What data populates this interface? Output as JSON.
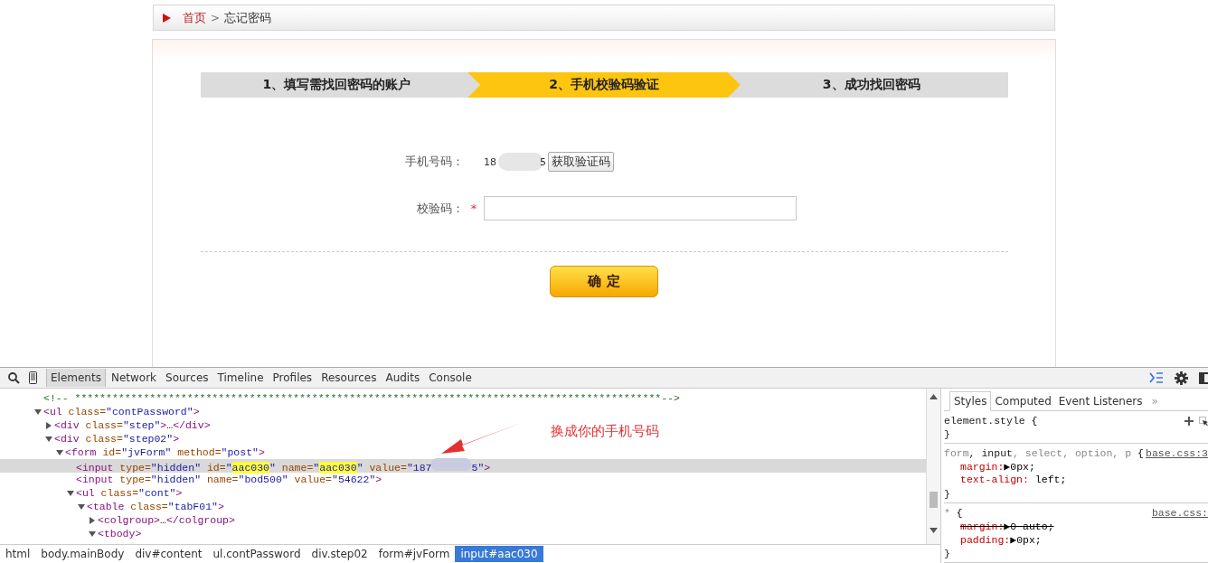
{
  "breadcrumb": {
    "home": "首页",
    "separator": ">",
    "current": "忘记密码"
  },
  "steps": [
    {
      "label": "1、填写需找回密码的账户",
      "selected": false
    },
    {
      "label": "2、手机校验码验证",
      "selected": true
    },
    {
      "label": "3、成功找回密码",
      "selected": false
    }
  ],
  "form": {
    "phone_label": "手机号码：",
    "phone_start": "18",
    "phone_end": "5",
    "send_code_button": "获取验证码",
    "code_label": "校验码：",
    "required_mark": "*",
    "submit_button": "确 定"
  },
  "devtools": {
    "tabs": [
      {
        "label": "Elements",
        "selected": true
      },
      {
        "label": "Network",
        "selected": false
      },
      {
        "label": "Sources",
        "selected": false
      },
      {
        "label": "Timeline",
        "selected": false
      },
      {
        "label": "Profiles",
        "selected": false
      },
      {
        "label": "Resources",
        "selected": false
      },
      {
        "label": "Audits",
        "selected": false
      },
      {
        "label": "Console",
        "selected": false
      }
    ],
    "tree": [
      {
        "parts": [
          {
            "kind": "comment",
            "t": "<!-- **********************************************************************************************-->"
          }
        ]
      },
      {
        "expanded": true,
        "parts": [
          {
            "kind": "tag",
            "t": "<ul"
          },
          {
            "kind": "attr",
            "t": " class="
          },
          {
            "kind": "value",
            "t": "\"contPassword\""
          },
          {
            "kind": "tag",
            "t": ">"
          }
        ],
        "children": [
          {
            "expanded": false,
            "parts": [
              {
                "kind": "tag",
                "t": "<div"
              },
              {
                "kind": "attr",
                "t": " class="
              },
              {
                "kind": "value",
                "t": "\"step\""
              },
              {
                "kind": "tag",
                "t": ">"
              },
              {
                "kind": "text",
                "t": "…"
              },
              {
                "kind": "tag",
                "t": "</div>"
              }
            ]
          },
          {
            "expanded": true,
            "parts": [
              {
                "kind": "tag",
                "t": "<div"
              },
              {
                "kind": "attr",
                "t": " class="
              },
              {
                "kind": "value",
                "t": "\"step02\""
              },
              {
                "kind": "tag",
                "t": ">"
              }
            ],
            "children": [
              {
                "expanded": true,
                "parts": [
                  {
                    "kind": "tag",
                    "t": "<form"
                  },
                  {
                    "kind": "attr",
                    "t": " id="
                  },
                  {
                    "kind": "value",
                    "t": "\"jvForm\""
                  },
                  {
                    "kind": "attr",
                    "t": " method="
                  },
                  {
                    "kind": "value",
                    "t": "\"post\""
                  },
                  {
                    "kind": "tag",
                    "t": ">"
                  }
                ],
                "children": [
                  {
                    "selected": true,
                    "parts": [
                      {
                        "kind": "tag",
                        "t": "<input"
                      },
                      {
                        "kind": "attr",
                        "t": " type="
                      },
                      {
                        "kind": "value",
                        "t": "\"hidden\""
                      },
                      {
                        "kind": "attr",
                        "t": " id="
                      },
                      {
                        "kind": "value",
                        "t": "\""
                      },
                      {
                        "kind": "mark",
                        "t": "aac030"
                      },
                      {
                        "kind": "value",
                        "t": "\""
                      },
                      {
                        "kind": "attr",
                        "t": " name="
                      },
                      {
                        "kind": "value",
                        "t": "\""
                      },
                      {
                        "kind": "mark",
                        "t": "aac030"
                      },
                      {
                        "kind": "value",
                        "t": "\""
                      },
                      {
                        "kind": "attr",
                        "t": " value="
                      },
                      {
                        "kind": "value",
                        "t": "\"187"
                      },
                      {
                        "kind": "blur"
                      },
                      {
                        "kind": "value",
                        "t": "5\""
                      },
                      {
                        "kind": "tag",
                        "t": ">"
                      }
                    ]
                  },
                  {
                    "selected": false,
                    "parts": [
                      {
                        "kind": "tag",
                        "t": "<input"
                      },
                      {
                        "kind": "attr",
                        "t": " type="
                      },
                      {
                        "kind": "value",
                        "t": "\"hidden\""
                      },
                      {
                        "kind": "attr",
                        "t": " name="
                      },
                      {
                        "kind": "value",
                        "t": "\"bod500\""
                      },
                      {
                        "kind": "attr",
                        "t": " value="
                      },
                      {
                        "kind": "value",
                        "t": "\"54622\""
                      },
                      {
                        "kind": "tag",
                        "t": ">"
                      }
                    ]
                  },
                  {
                    "expanded": true,
                    "parts": [
                      {
                        "kind": "tag",
                        "t": "<ul"
                      },
                      {
                        "kind": "attr",
                        "t": " class="
                      },
                      {
                        "kind": "value",
                        "t": "\"cont\""
                      },
                      {
                        "kind": "tag",
                        "t": ">"
                      }
                    ],
                    "children": [
                      {
                        "expanded": true,
                        "parts": [
                          {
                            "kind": "tag",
                            "t": "<table"
                          },
                          {
                            "kind": "attr",
                            "t": " class="
                          },
                          {
                            "kind": "value",
                            "t": "\"tabF01\""
                          },
                          {
                            "kind": "tag",
                            "t": ">"
                          }
                        ],
                        "children": [
                          {
                            "expanded": false,
                            "parts": [
                              {
                                "kind": "tag",
                                "t": "<colgroup>"
                              },
                              {
                                "kind": "text",
                                "t": "…"
                              },
                              {
                                "kind": "tag",
                                "t": "</colgroup>"
                              }
                            ]
                          },
                          {
                            "expanded": true,
                            "parts": [
                              {
                                "kind": "tag",
                                "t": "<tbody>"
                              }
                            ]
                          }
                        ]
                      }
                    ]
                  }
                ]
              }
            ]
          }
        ]
      }
    ],
    "annotation": "换成你的手机号码",
    "crumbs": [
      {
        "label": "html",
        "selected": false
      },
      {
        "label": "body.mainBody",
        "selected": false
      },
      {
        "label": "div#content",
        "selected": false
      },
      {
        "label": "ul.contPassword",
        "selected": false
      },
      {
        "label": "div.step02",
        "selected": false
      },
      {
        "label": "form#jvForm",
        "selected": false
      },
      {
        "label": "input#aac030",
        "selected": true
      }
    ],
    "style_tabs": [
      {
        "label": "Styles",
        "selected": true
      },
      {
        "label": "Computed",
        "selected": false
      },
      {
        "label": "Event Listeners",
        "selected": false
      }
    ],
    "style_tabs_more": "»",
    "rules": [
      {
        "selector": [
          {
            "text": "element.style",
            "matched": true
          }
        ],
        "open": " {",
        "close": "}"
      },
      {
        "selector": [
          {
            "text": "form",
            "matched": false
          },
          {
            "text": ", ",
            "matched": true
          },
          {
            "text": "input",
            "matched": true
          },
          {
            "text": ", select, option, p",
            "matched": false
          }
        ],
        "open": " {",
        "source": "base.css:3",
        "close": "}",
        "props": [
          {
            "name": "margin:",
            "value": "▶0px;",
            "overridden": false
          },
          {
            "name": "text-align:",
            "value": " left;",
            "overridden": false
          }
        ]
      },
      {
        "selector": [
          {
            "text": "*",
            "matched": false
          }
        ],
        "open": " {",
        "source": "base.css:",
        "close": "}",
        "props": [
          {
            "name": "margin:",
            "value": "▶0 auto;",
            "overridden": true
          },
          {
            "name": "padding:",
            "value": "▶0px;",
            "overridden": false
          }
        ]
      }
    ]
  }
}
